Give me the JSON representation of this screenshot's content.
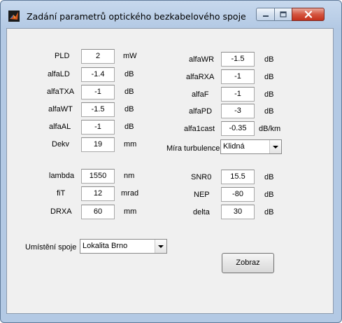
{
  "window": {
    "title": "Zadání parametrů optického bezkabelového spoje"
  },
  "left_params": [
    {
      "label": "PLD",
      "value": "2",
      "unit": "mW"
    },
    {
      "label": "alfaLD",
      "value": "-1.4",
      "unit": "dB"
    },
    {
      "label": "alfaTXA",
      "value": "-1",
      "unit": "dB"
    },
    {
      "label": "alfaWT",
      "value": "-1.5",
      "unit": "dB"
    },
    {
      "label": "alfaAL",
      "value": "-1",
      "unit": "dB"
    },
    {
      "label": "Dekv",
      "value": "19",
      "unit": "mm"
    }
  ],
  "left_params2": [
    {
      "label": "lambda",
      "value": "1550",
      "unit": "nm"
    },
    {
      "label": "fiT",
      "value": "12",
      "unit": "mrad"
    },
    {
      "label": "DRXA",
      "value": "60",
      "unit": "mm"
    }
  ],
  "right_params": [
    {
      "label": "alfaWR",
      "value": "-1.5",
      "unit": "dB"
    },
    {
      "label": "alfaRXA",
      "value": "-1",
      "unit": "dB"
    },
    {
      "label": "alfaF",
      "value": "-1",
      "unit": "dB"
    },
    {
      "label": "alfaPD",
      "value": "-3",
      "unit": "dB"
    },
    {
      "label": "alfa1cast",
      "value": "-0.35",
      "unit": "dB/km"
    }
  ],
  "turbulence": {
    "label": "Míra turbulence",
    "value": "Klidná"
  },
  "right_params2": [
    {
      "label": "SNR0",
      "value": "15.5",
      "unit": "dB"
    },
    {
      "label": "NEP",
      "value": "-80",
      "unit": "dB"
    },
    {
      "label": "delta",
      "value": "30",
      "unit": "dB"
    }
  ],
  "location": {
    "label": "Umístění spoje",
    "value": "Lokalita Brno"
  },
  "submit_label": "Zobraz"
}
